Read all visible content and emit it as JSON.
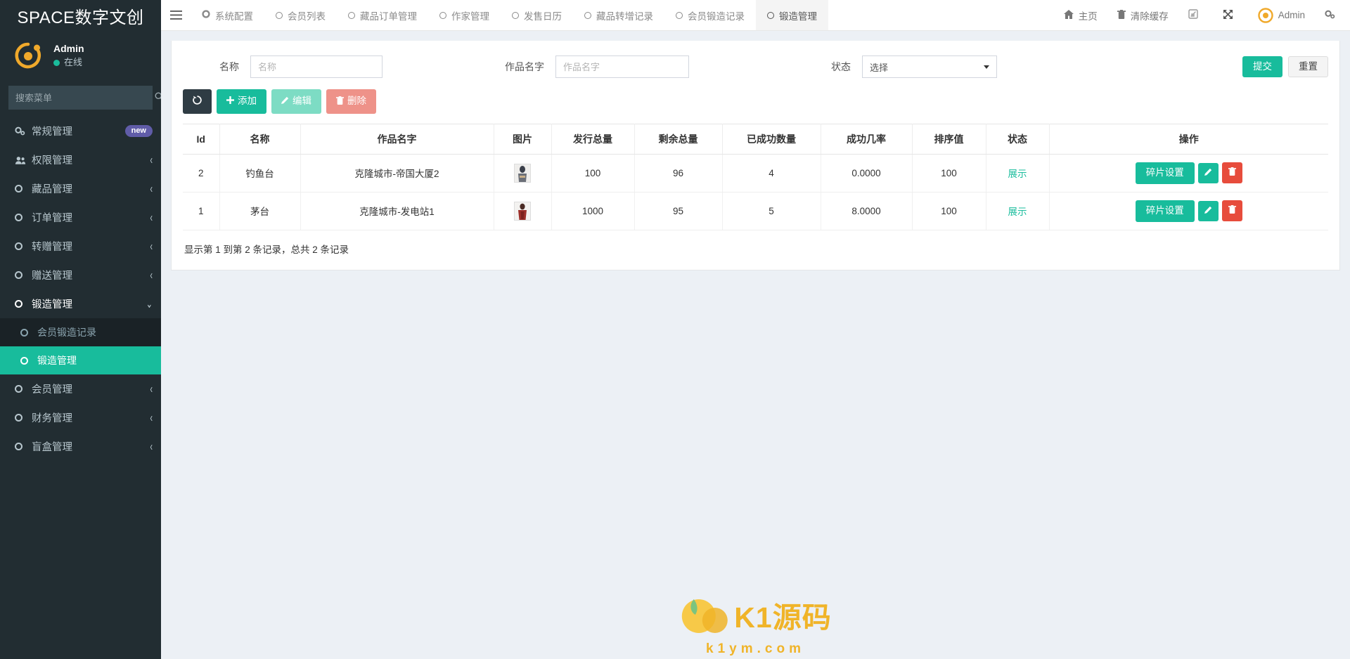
{
  "brand": {
    "title": "SPACE数字文创"
  },
  "user": {
    "name": "Admin",
    "status": "在线"
  },
  "sidebar": {
    "search_placeholder": "搜索菜单",
    "search_icon": "search-icon",
    "items": [
      {
        "label": "常规管理",
        "icon": "gears-icon",
        "badge": "new",
        "caret": ""
      },
      {
        "label": "权限管理",
        "icon": "users-icon",
        "badge": "",
        "caret": "‹"
      },
      {
        "label": "藏品管理",
        "icon": "circle-o-icon",
        "badge": "",
        "caret": "‹"
      },
      {
        "label": "订单管理",
        "icon": "circle-o-icon",
        "badge": "",
        "caret": "‹"
      },
      {
        "label": "转赠管理",
        "icon": "circle-o-icon",
        "badge": "",
        "caret": "‹"
      },
      {
        "label": "赠送管理",
        "icon": "circle-o-icon",
        "badge": "",
        "caret": "‹"
      },
      {
        "label": "锻造管理",
        "icon": "circle-o-icon",
        "badge": "",
        "caret": "⌄"
      },
      {
        "label": "会员管理",
        "icon": "circle-o-icon",
        "badge": "",
        "caret": "‹"
      },
      {
        "label": "财务管理",
        "icon": "circle-o-icon",
        "badge": "",
        "caret": "‹"
      },
      {
        "label": "盲盒管理",
        "icon": "circle-o-icon",
        "badge": "",
        "caret": "‹"
      }
    ],
    "submenu": [
      {
        "label": "会员锻造记录",
        "icon": "circle-o-icon"
      },
      {
        "label": "锻造管理",
        "icon": "circle-o-icon"
      }
    ]
  },
  "header": {
    "menu_toggle_icon": "hamburger-icon",
    "tabs": [
      {
        "label": "系统配置",
        "icon": "gear-icon"
      },
      {
        "label": "会员列表",
        "icon": "circle-o-icon"
      },
      {
        "label": "藏品订单管理",
        "icon": "circle-o-icon"
      },
      {
        "label": "作家管理",
        "icon": "circle-o-icon"
      },
      {
        "label": "发售日历",
        "icon": "circle-o-icon"
      },
      {
        "label": "藏品转增记录",
        "icon": "circle-o-icon"
      },
      {
        "label": "会员锻造记录",
        "icon": "circle-o-icon"
      },
      {
        "label": "锻造管理",
        "icon": "circle-o-icon"
      }
    ],
    "right": [
      {
        "label": "主页",
        "icon": "home-icon"
      },
      {
        "label": "清除缓存",
        "icon": "trash-icon"
      },
      {
        "label": "",
        "icon": "theme-icon"
      },
      {
        "label": "",
        "icon": "fullscreen-icon"
      },
      {
        "label": "Admin",
        "icon": "avatar-icon"
      },
      {
        "label": "",
        "icon": "gears-icon"
      }
    ]
  },
  "search_form": {
    "name_label": "名称",
    "name_placeholder": "名称",
    "name_value": "",
    "work_label": "作品名字",
    "work_placeholder": "作品名字",
    "work_value": "",
    "status_label": "状态",
    "status_value": "选择",
    "status_options": [
      "选择"
    ],
    "submit_label": "提交",
    "reset_label": "重置"
  },
  "toolbar": {
    "refresh_icon": "refresh-icon",
    "add_label": "添加",
    "edit_label": "编辑",
    "delete_label": "删除"
  },
  "table": {
    "columns": [
      "Id",
      "名称",
      "作品名字",
      "图片",
      "发行总量",
      "剩余总量",
      "已成功数量",
      "成功几率",
      "排序值",
      "状态",
      "操作"
    ],
    "rows": [
      {
        "id": "2",
        "name": "钓鱼台",
        "work": "克隆城市-帝国大厦2",
        "image": "thumbnail-collection-2",
        "total": "100",
        "remain": "96",
        "success_count": "4",
        "success_rate": "0.0000",
        "sort": "100",
        "status": "展示",
        "ops": {
          "card_label": "碎片设置",
          "edit_icon": "pencil-icon",
          "delete_icon": "trash-icon"
        }
      },
      {
        "id": "1",
        "name": "茅台",
        "work": "克隆城市-发电站1",
        "image": "thumbnail-collection-1",
        "total": "1000",
        "remain": "95",
        "success_count": "5",
        "success_rate": "8.0000",
        "sort": "100",
        "status": "展示",
        "ops": {
          "card_label": "碎片设置",
          "edit_icon": "pencil-icon",
          "delete_icon": "trash-icon"
        }
      }
    ],
    "footer_text": "显示第 1 到第 2 条记录，总共 2 条记录"
  },
  "watermark": {
    "text": "K1源码",
    "sub": "k1ym.com"
  },
  "colors": {
    "sidebar_bg": "#222d32",
    "accent_teal": "#18bc9c",
    "brand_orange": "#f0b429",
    "badge_purple": "#605ca8",
    "danger": "#e74c3c"
  }
}
